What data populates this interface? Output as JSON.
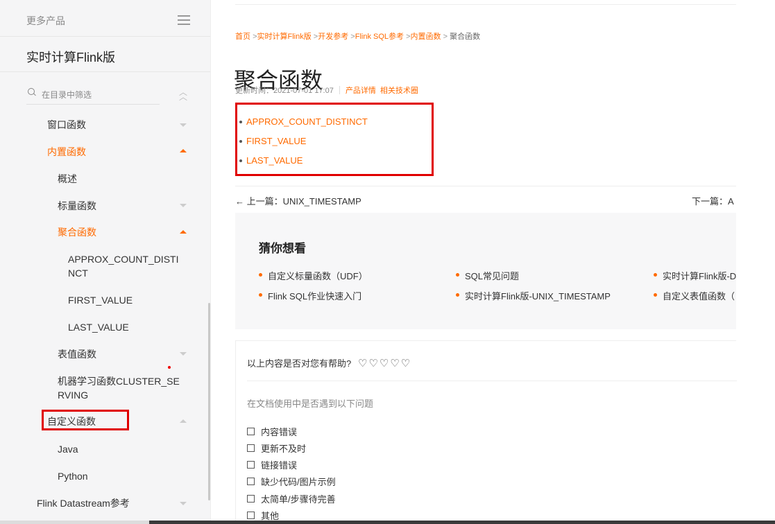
{
  "sidebar": {
    "more_products": "更多产品",
    "product_title": "实时计算Flink版",
    "filter_placeholder": "在目录中筛选",
    "items": [
      {
        "label": "窗口函数"
      },
      {
        "label": "内置函数"
      },
      {
        "label": "概述"
      },
      {
        "label": "标量函数"
      },
      {
        "label": "聚合函数"
      },
      {
        "label": "APPROX_COUNT_DISTINCT",
        "display": "APPROX_COUNT_DISTI NCT"
      },
      {
        "label": "FIRST_VALUE"
      },
      {
        "label": "LAST_VALUE"
      },
      {
        "label": "表值函数"
      },
      {
        "label": "机器学习函数CLUSTER_SERVING",
        "display": "机器学习函数CLUSTER_SE RVING"
      },
      {
        "label": "自定义函数"
      },
      {
        "label": "Java"
      },
      {
        "label": "Python"
      },
      {
        "label": "Flink Datastream参考"
      }
    ]
  },
  "breadcrumb": [
    {
      "label": "首页"
    },
    {
      "label": "实时计算Flink版"
    },
    {
      "label": "开发参考"
    },
    {
      "label": "Flink SQL参考"
    },
    {
      "label": "内置函数"
    },
    {
      "label": "聚合函数"
    }
  ],
  "page": {
    "title": "聚合函数",
    "updated": "更新时间：2021-07-01 17:07",
    "product_detail": "产品详情",
    "related_circle": "相关技术圈"
  },
  "functions": [
    "APPROX_COUNT_DISTINCT",
    "FIRST_VALUE",
    "LAST_VALUE"
  ],
  "nav": {
    "prev": "← 上一篇：UNIX_TIMESTAMP",
    "next": "下一篇：A"
  },
  "guess": {
    "title": "猜你想看",
    "items": [
      "自定义标量函数（UDF）",
      "SQL常见问题",
      "实时计算Flink版-D",
      "Flink SQL作业快速入门",
      "实时计算Flink版-UNIX_TIMESTAMP",
      "自定义表值函数（"
    ]
  },
  "feedback": {
    "question": "以上内容是否对您有帮助?",
    "hearts": [
      "♡",
      "♡",
      "♡",
      "♡",
      "♡"
    ],
    "subtitle": "在文档使用中是否遇到以下问题",
    "options": [
      "内容错误",
      "更新不及时",
      "链接错误",
      "缺少代码/图片示例",
      "太简单/步骤待完善",
      "其他"
    ]
  },
  "colors": {
    "accent": "#ff6a00",
    "annotation": "#e00000",
    "sidebar_bg": "#f5f5f6"
  }
}
